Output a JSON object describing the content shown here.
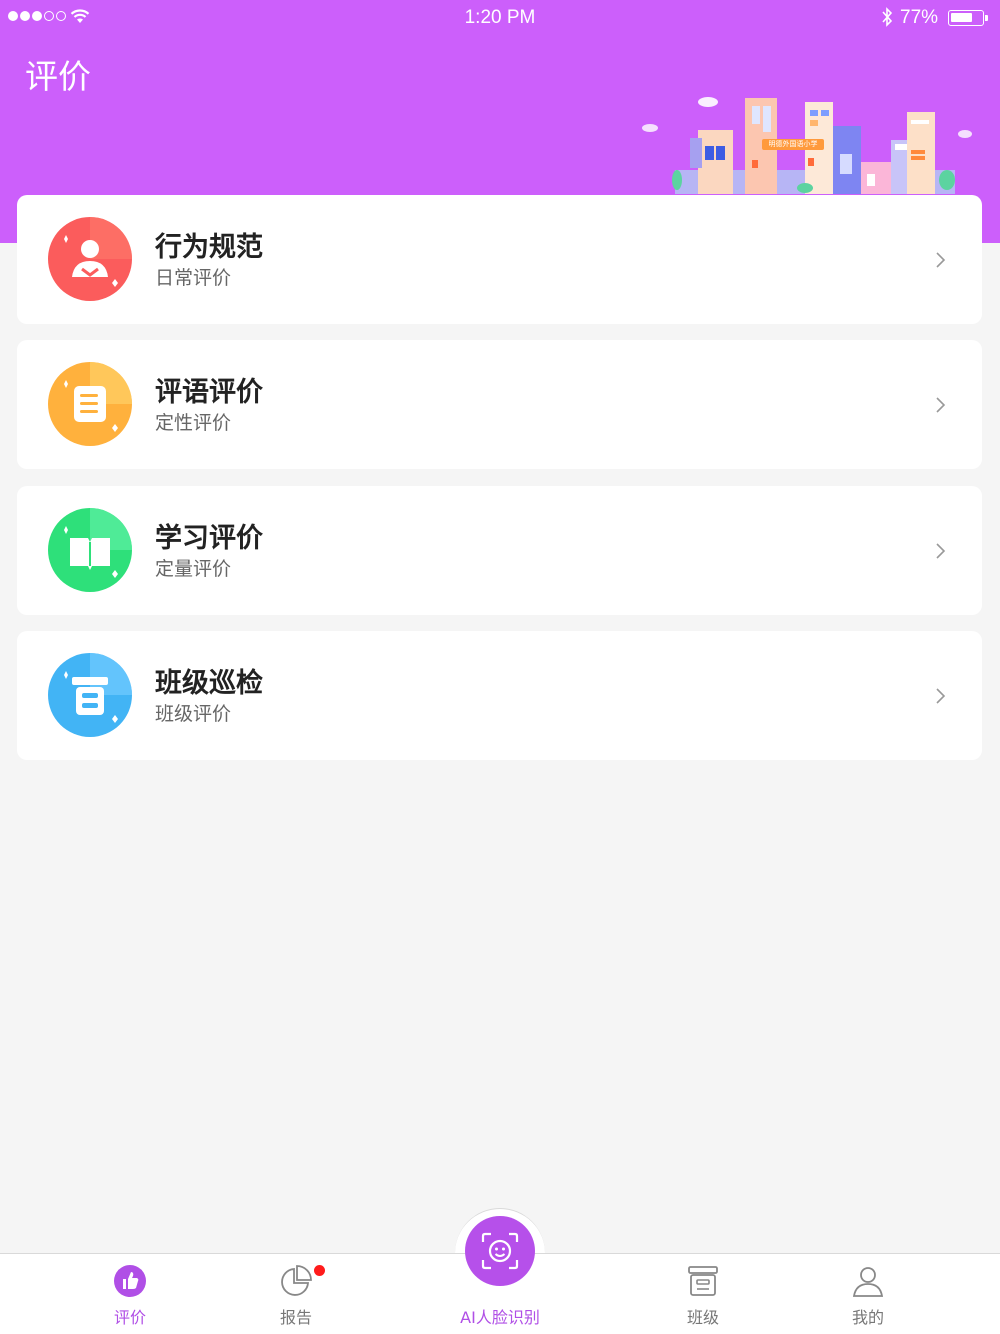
{
  "status_bar": {
    "time": "1:20 PM",
    "battery": "77%"
  },
  "header": {
    "title": "评价",
    "school_sign": "明德外国语小学",
    "background_color": "#cc5ffb"
  },
  "cards": [
    {
      "title": "行为规范",
      "subtitle": "日常评价",
      "icon": "person-icon",
      "color": "#fb5c5c"
    },
    {
      "title": "评语评价",
      "subtitle": "定性评价",
      "icon": "document-icon",
      "color": "#ffb13d"
    },
    {
      "title": "学习评价",
      "subtitle": "定量评价",
      "icon": "book-icon",
      "color": "#2ee07a"
    },
    {
      "title": "班级巡检",
      "subtitle": "班级评价",
      "icon": "classroom-icon",
      "color": "#42b4f5"
    }
  ],
  "tabbar": {
    "items": [
      {
        "label": "评价",
        "icon": "thumbs-up-icon",
        "active": true
      },
      {
        "label": "报告",
        "icon": "pie-chart-icon",
        "active": false,
        "badge": true
      },
      {
        "label": "AI人脸识别",
        "icon": "face-scan-icon",
        "active": true
      },
      {
        "label": "班级",
        "icon": "classroom-icon",
        "active": false
      },
      {
        "label": "我的",
        "icon": "user-icon",
        "active": false
      }
    ],
    "active_color": "#b04fe6"
  }
}
